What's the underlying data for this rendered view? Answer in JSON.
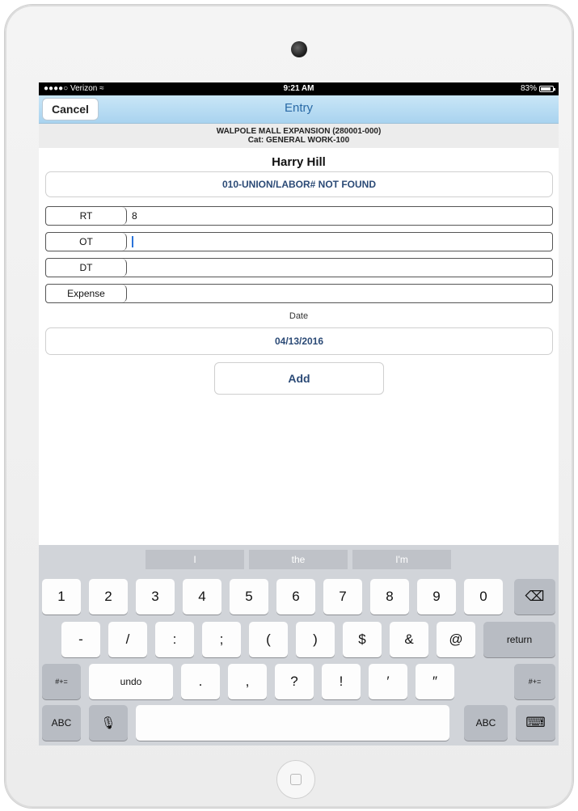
{
  "status": {
    "carrier": "●●●●○ Verizon ≈",
    "time": "9:21 AM",
    "battery": "83%",
    "battery_level": 0.83
  },
  "nav": {
    "title": "Entry",
    "cancel_label": "Cancel"
  },
  "project": {
    "line1": "WALPOLE MALL EXPANSION (280001-000)",
    "line2": "Cat: GENERAL WORK-100"
  },
  "employee": {
    "name": "Harry Hill"
  },
  "union": {
    "text": "010-UNION/LABOR# NOT FOUND"
  },
  "fields": {
    "rt": {
      "label": "RT",
      "value": "8"
    },
    "ot": {
      "label": "OT",
      "value": ""
    },
    "dt": {
      "label": "DT",
      "value": ""
    },
    "expense": {
      "label": "Expense",
      "value": ""
    }
  },
  "date": {
    "label": "Date",
    "value": "04/13/2016"
  },
  "add_label": "Add",
  "keyboard": {
    "suggestions": [
      "I",
      "the",
      "I'm"
    ],
    "row1": [
      "1",
      "2",
      "3",
      "4",
      "5",
      "6",
      "7",
      "8",
      "9",
      "0"
    ],
    "backspace_icon": "⌫",
    "row2": [
      "-",
      "/",
      ":",
      ";",
      "(",
      ")",
      "$",
      "&",
      "@"
    ],
    "return_label": "return",
    "row3_mode": "#+=",
    "undo_label": "undo",
    "row3": [
      ".",
      ",",
      "?",
      "!",
      "′",
      "″"
    ],
    "abc_label": "ABC",
    "mic_icon": "🎙",
    "keyboard_icon": "⌨"
  }
}
